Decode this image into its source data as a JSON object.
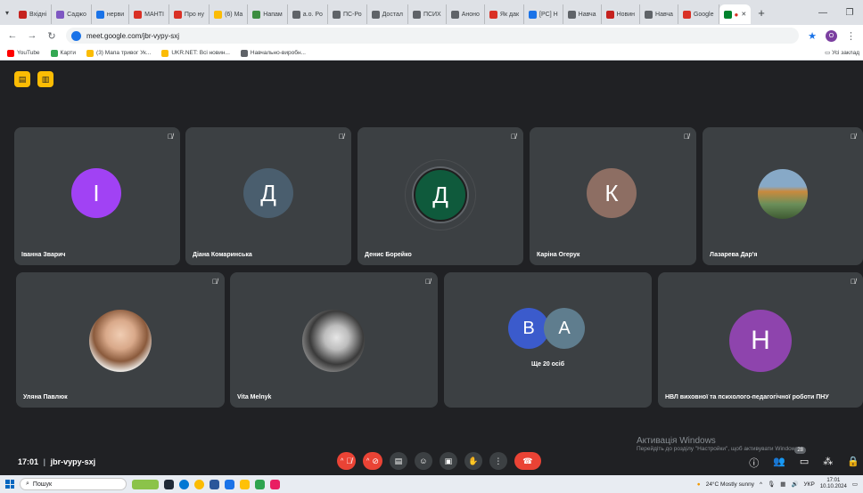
{
  "browser": {
    "tabs": [
      {
        "label": "Вхідні",
        "color": "#c5221f"
      },
      {
        "label": "Саджо",
        "color": "#7e57c2"
      },
      {
        "label": "нерви",
        "color": "#1a73e8"
      },
      {
        "label": "МАНТІ",
        "color": "#d93025"
      },
      {
        "label": "Про ну",
        "color": "#d93025"
      },
      {
        "label": "(6) Ma",
        "color": "#fbbc04"
      },
      {
        "label": "Напам",
        "color": "#3c8d40"
      },
      {
        "label": "a.o. Po",
        "color": "#5f6368"
      },
      {
        "label": "ПС-Ро",
        "color": "#5f6368"
      },
      {
        "label": "Достал",
        "color": "#5f6368"
      },
      {
        "label": "ПСИХ",
        "color": "#5f6368"
      },
      {
        "label": "Аноно",
        "color": "#5f6368"
      },
      {
        "label": "Як дак",
        "color": "#d93025"
      },
      {
        "label": "[PC] Н",
        "color": "#1a73e8"
      },
      {
        "label": "Навча",
        "color": "#5f6368"
      },
      {
        "label": "Новин",
        "color": "#c5221f"
      },
      {
        "label": "Навча",
        "color": "#5f6368"
      },
      {
        "label": "Google",
        "color": "#d93025"
      }
    ],
    "url": "meet.google.com/jbr-vypy-sxj",
    "profile_initial": "O",
    "bookmarks": [
      {
        "label": "YouTube",
        "color": "#ff0000"
      },
      {
        "label": "Карти",
        "color": "#34a853"
      },
      {
        "label": "(3) Мапа тривог Ук...",
        "color": "#fbbc04"
      },
      {
        "label": "UKR.NET: Всі новин...",
        "color": "#fbbc04"
      },
      {
        "label": "Навчально-виробн...",
        "color": "#5f6368"
      }
    ],
    "bookmarks_right": "Усі заклад"
  },
  "participants": [
    {
      "name": "Іванна Зварич",
      "initial": "І",
      "color": "#a142f4"
    },
    {
      "name": "Діана Комаринська",
      "initial": "Д",
      "color": "#4a5e6e"
    },
    {
      "name": "Денис Борейко",
      "initial": "Д",
      "color": "#0f5a3c"
    },
    {
      "name": "Каріна Огерук",
      "initial": "К",
      "color": "#8d6e63"
    },
    {
      "name": "Лазарева Дар'я",
      "initial": "",
      "color": "#6b8f5a"
    },
    {
      "name": "Уляна Павлюк",
      "initial": "",
      "color": "#c49a7e"
    },
    {
      "name": "Vita Melnyk",
      "initial": "",
      "color": "#9e9e9e"
    },
    {
      "name": "НВЛ виховної та психолого-педагогічної роботи ПНУ",
      "initial": "Н",
      "color": "#8e44ad"
    }
  ],
  "others": {
    "label": "Ще 20 осіб",
    "avatars": [
      {
        "initial": "В",
        "color": "#3b5bcc"
      },
      {
        "initial": "А",
        "color": "#5f7d8e"
      }
    ]
  },
  "meeting": {
    "time": "17:01",
    "code": "jbr-vypy-sxj",
    "people_count": "28"
  },
  "activation": {
    "title": "Активація Windows",
    "subtitle": "Перейдіть до розділу \"Настройки\", щоб активувати Windows."
  },
  "taskbar": {
    "search_placeholder": "Пошук",
    "weather": "24°C  Mostly sunny",
    "lang": "УКР",
    "time": "17:01",
    "date": "10.10.2024"
  }
}
